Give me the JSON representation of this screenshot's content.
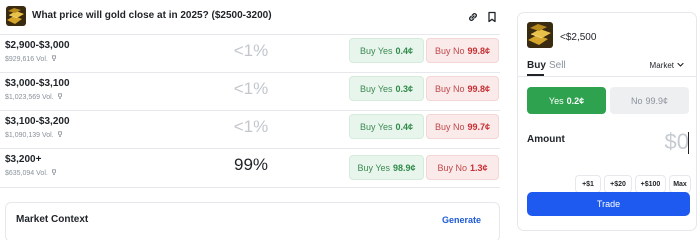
{
  "header": {
    "title": "What price will gold close at in 2025? ($2500-3200)",
    "link_icon": "link-icon",
    "bookmark_icon": "bookmark-icon"
  },
  "outcomes": [
    {
      "range": "$2,900-$3,000",
      "volume": "$929,616 Vol.",
      "chance": "<1%",
      "yes_label": "Buy Yes",
      "yes_price": "0.4¢",
      "no_label": "Buy No",
      "no_price": "99.8¢"
    },
    {
      "range": "$3,000-$3,100",
      "volume": "$1,023,569 Vol.",
      "chance": "<1%",
      "yes_label": "Buy Yes",
      "yes_price": "0.3¢",
      "no_label": "Buy No",
      "no_price": "99.8¢"
    },
    {
      "range": "$3,100-$3,200",
      "volume": "$1,090,139 Vol.",
      "chance": "<1%",
      "yes_label": "Buy Yes",
      "yes_price": "0.4¢",
      "no_label": "Buy No",
      "no_price": "99.7¢"
    },
    {
      "range": "$3,200+",
      "volume": "$635,094 Vol.",
      "chance": "99%",
      "yes_label": "Buy Yes",
      "yes_price": "98.9¢",
      "no_label": "Buy No",
      "no_price": "1.3¢"
    }
  ],
  "context": {
    "label": "Market Context",
    "action": "Generate"
  },
  "panel": {
    "title": "<$2,500",
    "tabs": {
      "buy": "Buy",
      "sell": "Sell"
    },
    "order_type": "Market",
    "yes": {
      "label": "Yes",
      "price": "0.2¢"
    },
    "no": {
      "label": "No",
      "price": "99.9¢"
    },
    "amount_label": "Amount",
    "amount_placeholder": "$0",
    "quick_amounts": [
      "+$1",
      "+$20",
      "+$100",
      "Max"
    ],
    "trade_label": "Trade"
  },
  "colors": {
    "yes_green": "#2ea24f",
    "no_red": "#c62f33",
    "trade_blue": "#1f5af0",
    "link_blue": "#1e5bd6"
  }
}
